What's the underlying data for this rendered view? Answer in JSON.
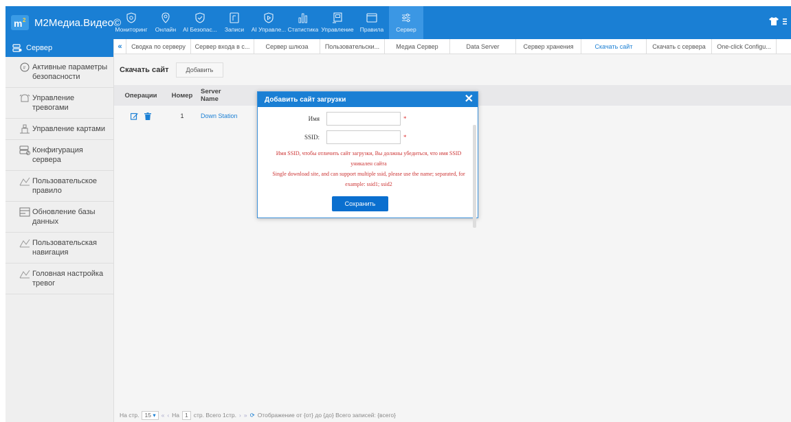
{
  "app": {
    "title": "M2Медиа.Видео©"
  },
  "nav": [
    {
      "label": "Мониторинг",
      "icon": "shield-icon"
    },
    {
      "label": "Онлайн",
      "icon": "location-pin-icon"
    },
    {
      "label": "AI Безопас...",
      "icon": "shield-check-icon"
    },
    {
      "label": "Записи",
      "icon": "record-icon"
    },
    {
      "label": "AI Управле...",
      "icon": "play-shield-icon"
    },
    {
      "label": "Статистика",
      "icon": "bar-chart-icon"
    },
    {
      "label": "Управление",
      "icon": "panel-icon"
    },
    {
      "label": "Правила",
      "icon": "window-icon"
    },
    {
      "label": "Сервер",
      "icon": "sliders-icon",
      "active": true
    }
  ],
  "sidebar": {
    "header": "Сервер",
    "items": [
      {
        "label": "Активные параметры безопасности",
        "icon": "shield-badge-icon"
      },
      {
        "label": "Управление тревогами",
        "icon": "alarm-icon"
      },
      {
        "label": "Управление картами",
        "icon": "map-icon"
      },
      {
        "label": "Конфигурация сервера",
        "icon": "server-config-icon"
      },
      {
        "label": "Пользовательское правило",
        "icon": "rule-icon"
      },
      {
        "label": "Обновление базы данных",
        "icon": "database-update-icon"
      },
      {
        "label": "Пользовательская навигация",
        "icon": "navigation-icon"
      },
      {
        "label": "Головная настройка тревог",
        "icon": "alarm-settings-icon"
      }
    ]
  },
  "tabs": [
    {
      "label": "Сводка по серверу",
      "w": 94
    },
    {
      "label": "Сервер входа в с...",
      "w": 92
    },
    {
      "label": "Сервер шлюза",
      "w": 96
    },
    {
      "label": "Пользовательски...",
      "w": 94
    },
    {
      "label": "Медиа Сервер",
      "w": 95
    },
    {
      "label": "Data Server",
      "w": 96
    },
    {
      "label": "Сервер хранения",
      "w": 95
    },
    {
      "label": "Скачать сайт",
      "w": 95,
      "active": true
    },
    {
      "label": "Скачать с сервера",
      "w": 95
    },
    {
      "label": "One-click Configu...",
      "w": 94
    }
  ],
  "page": {
    "title": "Скачать сайт",
    "add_button": "Добавить"
  },
  "table": {
    "columns": [
      "Операции",
      "Номер",
      "Server Name"
    ],
    "rows": [
      {
        "number": "1",
        "server_name": "Down Station"
      }
    ]
  },
  "footer": {
    "per_page_label": "На стр.",
    "per_page_value": "15",
    "page_label": "На",
    "page_value": "1",
    "total_label": "стр. Всего 1стр.",
    "display_text": "Отображение от {от} до {до} Всего записей: {всего}"
  },
  "modal": {
    "title": "Добавить сайт загрузки",
    "name_label": "Имя",
    "ssid_label": "SSID:",
    "name_value": "",
    "ssid_value": "",
    "required_mark": "*",
    "note_ru_1": "Имя SSID, чтобы отличить сайт загрузки, Вы должны убедиться, что имя SSID",
    "note_ru_2": "уникален сайта",
    "note_en_1": "Single download site, and can support multiple ssid, please use the name; separated, for",
    "note_en_2": "example: ssid1; ssid2",
    "save_button": "Сохранить"
  },
  "colors": {
    "primary": "#1a7fd4",
    "active_nav": "#3b97e4",
    "required": "#d33333",
    "link": "#1a7fd4"
  }
}
